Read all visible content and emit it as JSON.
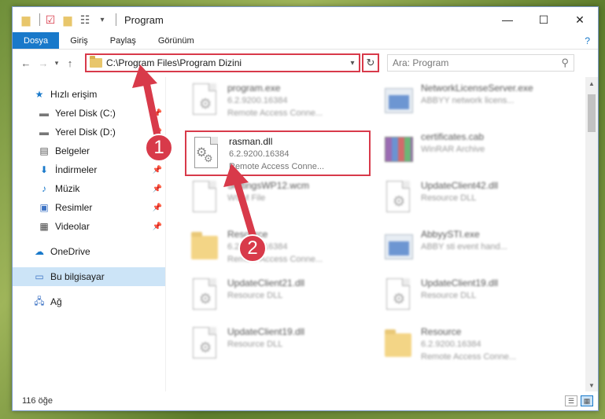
{
  "window": {
    "title": "Program",
    "controls": {
      "minimize": "—",
      "maximize": "☐",
      "close": "✕"
    }
  },
  "ribbon": {
    "tabs": [
      {
        "label": "Dosya",
        "active": true
      },
      {
        "label": "Giriş"
      },
      {
        "label": "Paylaş"
      },
      {
        "label": "Görünüm"
      }
    ],
    "help": "?"
  },
  "navigation": {
    "address": "C:\\Program Files\\Program Dizini",
    "search_placeholder": "Ara: Program"
  },
  "sidebar": {
    "quick_access": "Hızlı erişim",
    "items": [
      {
        "label": "Yerel Disk (C:)",
        "icon": "drive-icon",
        "pinned": true
      },
      {
        "label": "Yerel Disk (D:)",
        "icon": "drive-icon",
        "pinned": true
      },
      {
        "label": "Belgeler",
        "icon": "documents-icon",
        "pinned": true
      },
      {
        "label": "İndirmeler",
        "icon": "download-icon",
        "pinned": true
      },
      {
        "label": "Müzik",
        "icon": "music-icon",
        "pinned": true
      },
      {
        "label": "Resimler",
        "icon": "pictures-icon",
        "pinned": true
      },
      {
        "label": "Videolar",
        "icon": "videos-icon",
        "pinned": true
      }
    ],
    "onedrive": "OneDrive",
    "this_pc": "Bu bilgisayar",
    "network": "Ağ"
  },
  "files": [
    {
      "name": "program.exe",
      "line1": "6.2.9200.16384",
      "line2": "Remote Access Conne...",
      "icon": "exe-icon"
    },
    {
      "name": "NetworkLicenseServer.exe",
      "line1": "ABBYY network licens...",
      "line2": "",
      "icon": "app-icon"
    },
    {
      "name": "rasman.dll",
      "line1": "6.2.9200.16384",
      "line2": "Remote Access Conne...",
      "icon": "dll-gear-icon"
    },
    {
      "name": "certificates.cab",
      "line1": "WinRAR Archive",
      "line2": "",
      "icon": "archive-icon"
    },
    {
      "name": "SettingsWP12.wcm",
      "line1": "WCM File",
      "line2": "",
      "icon": "file-icon"
    },
    {
      "name": "UpdateClient42.dll",
      "line1": "Resource DLL",
      "line2": "",
      "icon": "dll-gear-icon"
    },
    {
      "name": "Resource",
      "line1": "6.2.9200.16384",
      "line2": "Remote Access Conne...",
      "icon": "folder-icon"
    },
    {
      "name": "AbbyySTI.exe",
      "line1": "ABBY sti event hand...",
      "line2": "",
      "icon": "app-icon"
    },
    {
      "name": "UpdateClient21.dll",
      "line1": "Resource DLL",
      "line2": "",
      "icon": "dll-gear-icon"
    },
    {
      "name": "UpdateClient19.dll",
      "line1": "Resource DLL",
      "line2": "",
      "icon": "dll-gear-icon"
    },
    {
      "name": "UpdateClient19.dll",
      "line1": "Resource DLL",
      "line2": "",
      "icon": "dll-gear-icon"
    },
    {
      "name": "Resource",
      "line1": "6.2.9200.16384",
      "line2": "Remote Access Conne...",
      "icon": "folder-icon"
    }
  ],
  "annotations": {
    "step1": "1",
    "step2": "2"
  },
  "status": {
    "count": "116 öğe"
  },
  "colors": {
    "accent": "#1979ca",
    "highlight": "#d83a4a"
  }
}
